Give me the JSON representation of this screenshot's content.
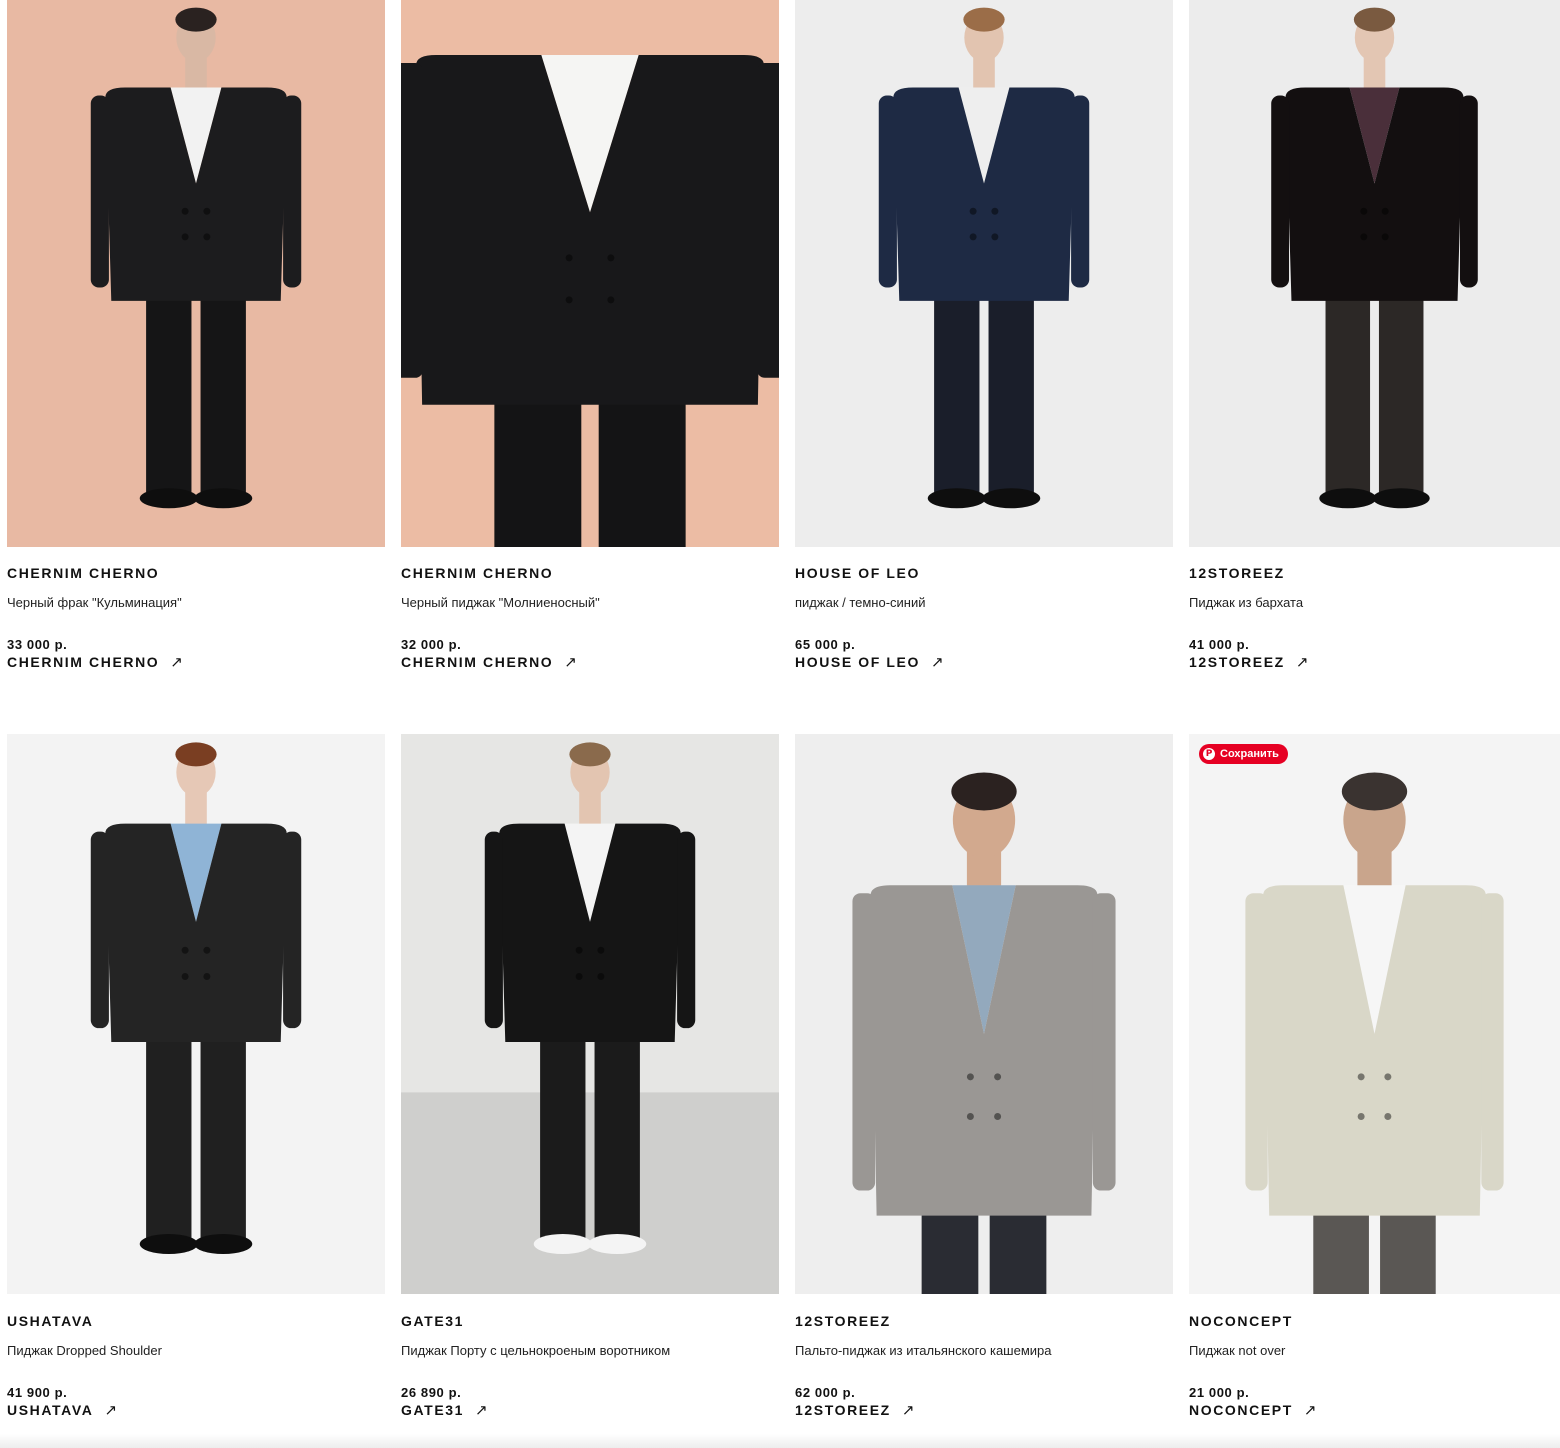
{
  "products": [
    {
      "brand": "CHERNIM CHERNO",
      "title": "Черный фрак \"Кульминация\"",
      "price": "33 000 р.",
      "shop": "CHERNIM CHERNO",
      "photo": {
        "bg": "#e8b9a3",
        "jacket": "#1c1c1e",
        "pants": "#151516",
        "shirt": "#f2f2f2",
        "skin": "#d9b8a4",
        "hair": "#2a2220",
        "pose": "full"
      }
    },
    {
      "brand": "CHERNIM CHERNO",
      "title": "Черный пиджак \"Молниеносный\"",
      "price": "32 000 р.",
      "shop": "CHERNIM CHERNO",
      "photo": {
        "bg": "#ecbca4",
        "jacket": "#18181a",
        "pants": "#141415",
        "shirt": "#f5f5f3",
        "skin": "#e1c2ae",
        "hair": "#6b5a49",
        "pose": "crop"
      }
    },
    {
      "brand": "HOUSE OF LEO",
      "title": "пиджак / темно-синий",
      "price": "65 000 р.",
      "shop": "HOUSE OF LEO",
      "photo": {
        "bg": "#ededed",
        "jacket": "#1e2a44",
        "pants": "#1a1e2a",
        "shirt": "#eeeeee",
        "skin": "#e2c4b0",
        "hair": "#9b6d48",
        "pose": "full"
      }
    },
    {
      "brand": "12STOREEZ",
      "title": "Пиджак из бархата",
      "price": "41 000 р.",
      "shop": "12STOREEZ",
      "photo": {
        "bg": "#ececec",
        "jacket": "#130f10",
        "pants": "#2c2826",
        "shirt": "#4a2f3a",
        "skin": "#e3c6b3",
        "hair": "#7a5a40",
        "pose": "full"
      }
    },
    {
      "brand": "USHATAVA",
      "title": "Пиджак Dropped Shoulder",
      "price": "41 900 р.",
      "shop": "USHATAVA",
      "photo": {
        "bg": "#f3f3f3",
        "jacket": "#242424",
        "pants": "#202020",
        "shirt": "#8fb4d6",
        "skin": "#e6c8b6",
        "hair": "#7a3e22",
        "pose": "full"
      }
    },
    {
      "brand": "GATE31",
      "title": "Пиджак Порту с цельнокроеным воротником",
      "price": "26 890 р.",
      "shop": "GATE31",
      "photo": {
        "bg": "#e6e6e4",
        "jacket": "#151515",
        "pants": "#1b1b1b",
        "shirt": "#f4f4f4",
        "skin": "#e3c5b1",
        "hair": "#8a6a4c",
        "pose": "full"
      }
    },
    {
      "brand": "12STOREEZ",
      "title": "Пальто-пиджак из итальянского кашемира",
      "price": "62 000 р.",
      "shop": "12STOREEZ",
      "photo": {
        "bg": "#eeeeee",
        "jacket": "#9a9794",
        "pants": "#2a2c33",
        "shirt": "#93a9bd",
        "skin": "#d2a98e",
        "hair": "#2b2220",
        "pose": "half"
      }
    },
    {
      "brand": "NOCONCEPT",
      "title": "Пиджак not over",
      "price": "21 000 р.",
      "shop": "NOCONCEPT",
      "photo": {
        "bg": "#f4f4f4",
        "jacket": "#d9d7c8",
        "pants": "#5a5754",
        "shirt": "#f6f6f6",
        "skin": "#c9a58c",
        "hair": "#3a3330",
        "pose": "half"
      }
    }
  ],
  "pinterest": {
    "label": "Сохранить",
    "icon": "pinterest-icon",
    "color": "#e60023"
  },
  "ui": {
    "link_arrow": "↗",
    "pin_glyph": "P"
  }
}
